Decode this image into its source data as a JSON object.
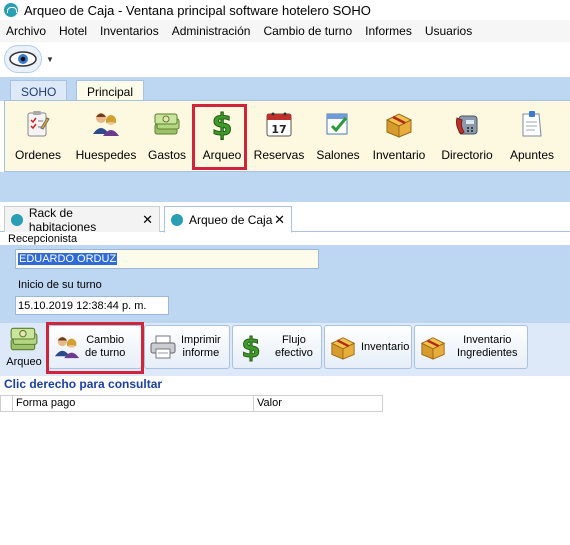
{
  "window": {
    "title": "Arqueo de Caja - Ventana principal software hotelero SOHO",
    "icon": "soho-app-icon"
  },
  "menubar": {
    "items": [
      "Archivo",
      "Hotel",
      "Inventarios",
      "Administración",
      "Cambio de turno",
      "Informes",
      "Usuarios"
    ]
  },
  "quickbar": {
    "eye_button_icon": "eye-icon",
    "dropdown_glyph": "▼"
  },
  "ribbon": {
    "tabs": [
      "SOHO",
      "Principal"
    ],
    "active_tab": "Principal",
    "buttons": [
      {
        "label": "Ordenes",
        "icon": "clipboard-checklist-icon"
      },
      {
        "label": "Huespedes",
        "icon": "guests-icon"
      },
      {
        "label": "Gastos",
        "icon": "money-stack-icon"
      },
      {
        "label": "Arqueo",
        "icon": "dollar-sign-icon"
      },
      {
        "label": "Reservas",
        "icon": "calendar-icon",
        "day": "17"
      },
      {
        "label": "Salones",
        "icon": "checklist-icon"
      },
      {
        "label": "Inventario",
        "icon": "box-icon"
      },
      {
        "label": "Directorio",
        "icon": "phone-icon"
      },
      {
        "label": "Apuntes",
        "icon": "note-icon"
      }
    ],
    "highlighted_button": "Arqueo"
  },
  "doc_tabs": [
    {
      "label": "Rack de habitaciones",
      "close": "✕"
    },
    {
      "label": "Arqueo de Caja",
      "close": "✕"
    }
  ],
  "form": {
    "recepcionista_label": "Recepcionista",
    "recepcionista_value": "EDUARDO ORDUZ",
    "inicio_label": "Inicio de su turno",
    "inicio_value": "15.10.2019 12:38:44 p. m."
  },
  "action_buttons": {
    "arqueo": {
      "label": "Arqueo",
      "icon": "money-stack-icon"
    },
    "cambio_turno": {
      "line1": "Cambio",
      "line2": "de turno",
      "icon": "guests-icon"
    },
    "imprimir": {
      "line1": "Imprimir",
      "line2": "informe",
      "icon": "printer-icon"
    },
    "flujo": {
      "line1": "Flujo",
      "line2": "efectivo",
      "icon": "dollar-sign-icon"
    },
    "inventario": {
      "line1": "Inventario",
      "icon": "box-icon"
    },
    "inventario_ingredientes": {
      "line1": "Inventario",
      "line2": "Ingredientes",
      "icon": "box-icon"
    }
  },
  "hint": "Clic derecho para consultar",
  "grid": {
    "columns": [
      "Forma pago",
      "Valor"
    ]
  },
  "colors": {
    "ribbon_blue": "#bdd6f1",
    "ribbon_cream": "#fdf8e0",
    "highlight_red": "#d0243a",
    "hint_blue": "#1a3fa0"
  }
}
